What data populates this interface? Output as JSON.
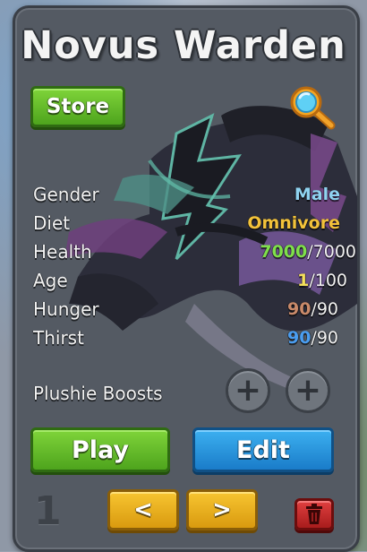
{
  "creature": {
    "name": "Novus Warden"
  },
  "buttons": {
    "store": "Store",
    "play": "Play",
    "edit": "Edit",
    "prev": "<",
    "next": ">"
  },
  "stats": {
    "gender": {
      "label": "Gender",
      "value": "Male",
      "color": "#8fd3f0"
    },
    "diet": {
      "label": "Diet",
      "value": "Omnivore",
      "color": "#f2c23a"
    },
    "health": {
      "label": "Health",
      "current": "7000",
      "max": "/7000",
      "color": "#7fe04a"
    },
    "age": {
      "label": "Age",
      "current": "1",
      "max": "/100",
      "color": "#f5e05a"
    },
    "hunger": {
      "label": "Hunger",
      "current": "90",
      "max": "/90",
      "color": "#c98a6a"
    },
    "thirst": {
      "label": "Thirst",
      "current": "90",
      "max": "/90",
      "color": "#4a9df0"
    }
  },
  "plushie": {
    "label": "Plushie Boosts",
    "slot_symbol": "+"
  },
  "page": {
    "number": "1"
  },
  "icons": {
    "search": "magnifier-icon",
    "trash": "trash-icon"
  }
}
